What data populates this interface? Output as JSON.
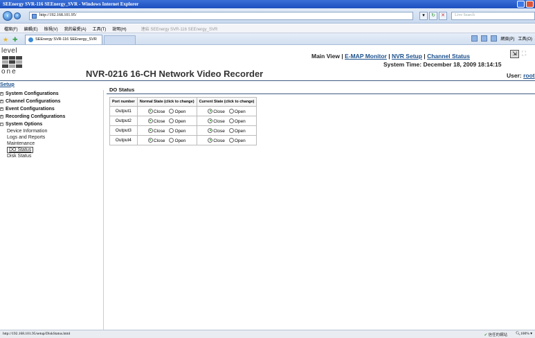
{
  "window": {
    "title": "SEEnergy SVR-116 SEEnergy_SVR - Windows Internet Explorer"
  },
  "address": {
    "url": "http://192.168.101.95/",
    "search_placeholder": "Live Search"
  },
  "menu": {
    "items": [
      "檔案(F)",
      "編輯(E)",
      "檢視(V)",
      "我的最愛(A)",
      "工具(T)",
      "說明(H)"
    ],
    "separator_text": "連結 SEEnergy SVR-116 SEEnergy_SVR"
  },
  "tab": {
    "label": "SEEnergy SVR-116 SEEnergy_SVR"
  },
  "commandbar": {
    "page": "網頁(P)",
    "tools": "工具(O)"
  },
  "header": {
    "brand_top": "level",
    "brand_bottom": "one",
    "main_view": "Main View",
    "sep": "|",
    "nav": [
      "E-MAP Monitor",
      "NVR Setup",
      "Channel Status"
    ],
    "system_time_label": "System Time:",
    "system_time": "December 18, 2009 18:14:15",
    "device_title": "NVR-0216 16-CH Network Video Recorder",
    "user_label": "User:",
    "user": "root"
  },
  "sidebar": {
    "setup": "Setup",
    "groups": [
      {
        "label": "System Configurations",
        "expanded": false
      },
      {
        "label": "Channel Configurations",
        "expanded": false
      },
      {
        "label": "Event Configurations",
        "expanded": false
      },
      {
        "label": "Recording Configurations",
        "expanded": false
      },
      {
        "label": "System Options",
        "expanded": true
      }
    ],
    "sub_items": [
      "Device Information",
      "Logs and Reports",
      "Maintenance",
      "DO Status",
      "Disk Status"
    ],
    "active": "DO Status"
  },
  "main": {
    "title": "DO Status",
    "columns": [
      "Port number",
      "Normal State (click to change)",
      "Current State (click to change)"
    ],
    "option_close": "Close",
    "option_open": "Open",
    "rows": [
      {
        "port": "Output1",
        "normal": "Close",
        "current": "Close"
      },
      {
        "port": "Output2",
        "normal": "Close",
        "current": "Close"
      },
      {
        "port": "Output3",
        "normal": "Close",
        "current": "Close"
      },
      {
        "port": "Output4",
        "normal": "Close",
        "current": "Close"
      }
    ]
  },
  "statusbar": {
    "url": "http://192.168.101.95/setup/DiskStatus.html",
    "zone": "信任的網站",
    "zoom": "100%"
  }
}
